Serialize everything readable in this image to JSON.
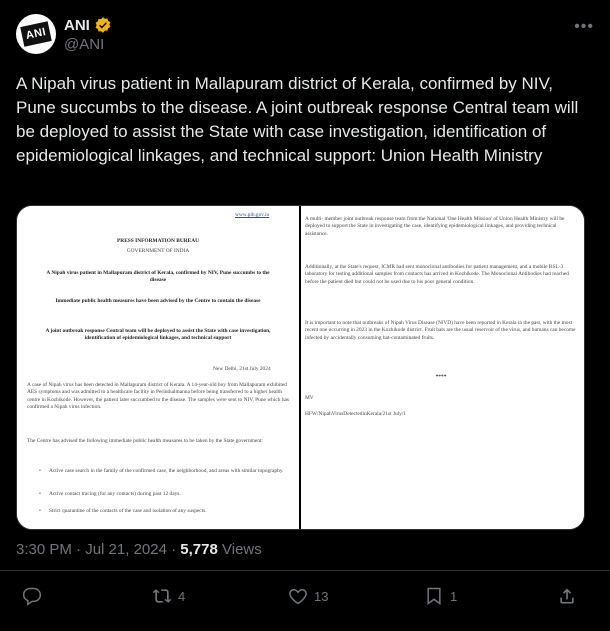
{
  "author": {
    "name": "ANI",
    "handle": "@ANI",
    "avatar_text": "ANI"
  },
  "more_label": "•••",
  "tweet_text": "A Nipah virus patient in Mallapuram district of Kerala, confirmed by NIV, Pune succumbs to the disease. A joint outbreak response Central team will be deployed to assist the State with case investigation, identification of epidemiological linkages, and technical support: Union Health Ministry",
  "document_left": {
    "url": "www.pib.gov.in",
    "bureau": "PRESS INFORMATION BUREAU",
    "government": "GOVERNMENT OF INDIA",
    "headline1": "A Nipah virus patient in Mallapuram district of Kerala, confirmed by NIV, Pune succumbs to the disease",
    "headline2": "Immediate public health measures have been advised by the Centre to contain the disease",
    "headline3": "A joint outbreak response Central team will be deployed to assist the State with case investigation, identification of epidemiological linkages, and technical support",
    "dateline": "New Delhi, 21st July 2024",
    "para1": "A case of Nipah virus has been detected in Mallapuram district of Kerala. A 14-year-old boy from Mallapuram exhibited AES symptoms and was admitted to a healthcare facility in Perinthalmanna before being transferred to a higher health centre in Kozhikode. However, the patient later succumbed to the disease. The samples were sent to NIV, Pune which has confirmed a Nipah virus infection.",
    "para2": "The Centre has advised the following immediate public health measures to be taken by the State government:",
    "bullet1": "Active case search in the family of the confirmed case, the neighborhood, and areas with similar topography.",
    "bullet2": "Active contact tracing (for any contacts) during past 12 days.",
    "bullet3": "Strict quarantine of the contacts of the case and isolation of any suspects."
  },
  "document_right": {
    "para1": "A multi- member joint outbreak response team from the National 'One Health Mission' of Union Health Ministry will be deployed to support the State in investigating the case, identifying epidemiological linkages, and providing technical assistance.",
    "para2": "Additionally, at the State's request, ICMR had sent monoclonal antibodies for patient management, and a mobile BSL-3 laboratory for testing additional samples from contacts has arrived in Kozhikode. The Monoclonal Antibodies had reached before the patient died but could not be used due to his poor general condition.",
    "para3": "It is important to note that outbreaks of Nipah Virus Disease (NiVD) have been reported in Kerala in the past, with the most recent one occurring in 2023 in the Kozhikode district. Fruit bats are the usual reservoir of the virus, and humans can become infected by accidentally consuming bat-contaminated fruits.",
    "stars": "****",
    "initials": "MV",
    "reference": "HFW/NipahVirusDetectedinKerala/21st July/1"
  },
  "meta": {
    "time": "3:30 PM",
    "dot1": "·",
    "date": "Jul 21, 2024",
    "dot2": "·",
    "views": "5,778",
    "views_label": "Views"
  },
  "stats": {
    "replies": "",
    "reposts": "4",
    "likes": "13",
    "bookmarks": "1"
  },
  "colors": {
    "background": "#000000",
    "text": "#e7e9ea",
    "secondary": "#71767b",
    "verified": "#f4b400"
  }
}
